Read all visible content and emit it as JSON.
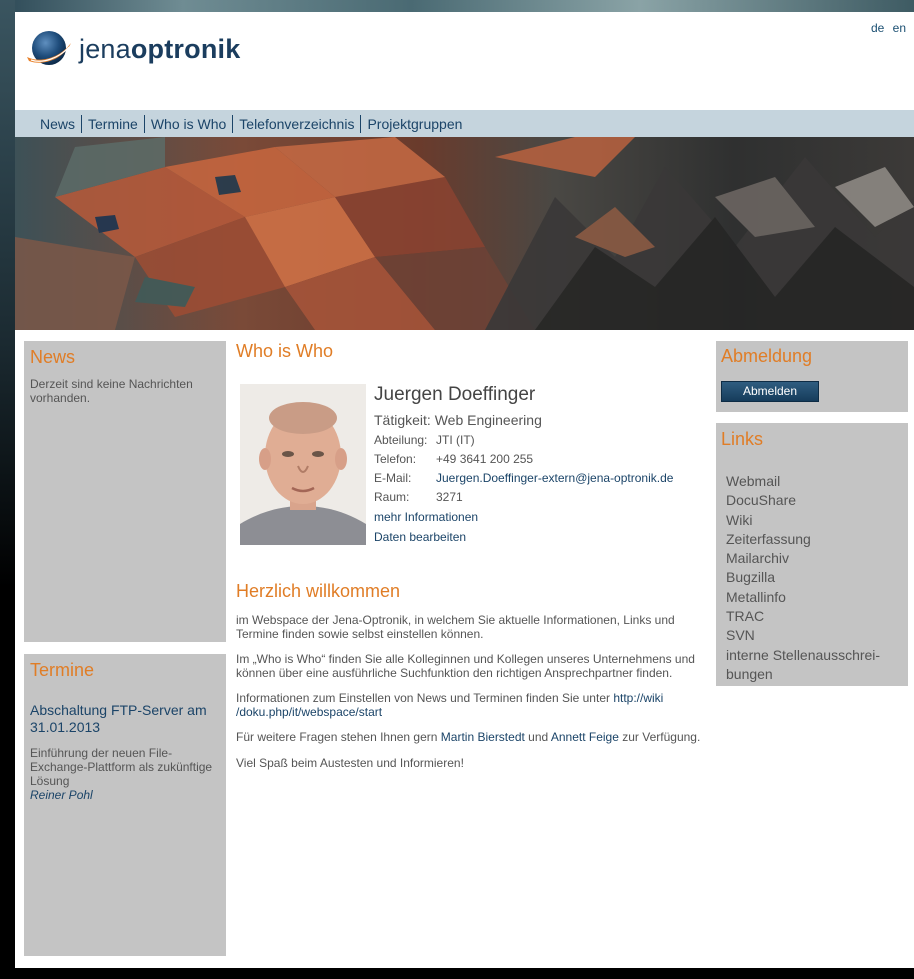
{
  "header": {
    "logo_prefix": "jena",
    "logo_bold": "optronik",
    "lang": [
      "de",
      "en"
    ]
  },
  "nav": [
    "News",
    "Termine",
    "Who is Who",
    "Telefonverzeichnis",
    "Projektgruppen"
  ],
  "news": {
    "title": "News",
    "text": "Derzeit sind keine Nachrichten vorhanden."
  },
  "termine": {
    "title": "Termine",
    "event_title": "Abschaltung FTP-Server am 31.01.2013",
    "event_desc": "Einführung der neuen File-Exchange-Plattform als zukünftige Lösung",
    "event_author": "Reiner Pohl"
  },
  "whoiswho": {
    "title": "Who is Who",
    "name": "Juergen Doeffinger",
    "job_label": "Tätigkeit:",
    "job_value": "Web Engineering",
    "rows": [
      {
        "label": "Abteilung:",
        "value": "JTI (IT)"
      },
      {
        "label": "Telefon:",
        "value": "+49 3641 200 255"
      },
      {
        "label": "E-Mail:",
        "value": "Juergen.Doeffinger-extern@jena-optronik.de"
      },
      {
        "label": "Raum:",
        "value": "3271"
      }
    ],
    "more_link": "mehr Informationen",
    "edit_link": "Daten bearbeiten"
  },
  "welcome": {
    "title": "Herzlich willkommen",
    "p1": "im Webspace der Jena-Optronik, in welchem Sie aktuelle Informationen, Links und Termine finden sowie selbst einstellen können.",
    "p2": "Im „Who is Who“ finden Sie alle Kolleginnen und Kollegen unseres Unternehmens und können über eine ausführliche Suchfunktion den richtigen Ansprechpartner finden.",
    "p3_text": "Informationen zum Einstellen von News und Terminen finden Sie unter ",
    "p3_link_a": "http://wiki",
    "p3_link_b": "/doku.php/it/webspace/start",
    "p4_pre": "Für weitere Fragen stehen Ihnen gern ",
    "p4_name1": "Martin Bierstedt",
    "p4_mid": " und ",
    "p4_name2": "Annett Feige",
    "p4_post": " zur Verfügung.",
    "p5": "Viel Spaß beim Austesten und Informieren!"
  },
  "abmeldung": {
    "title": "Abmeldung",
    "button": "Abmelden"
  },
  "links": {
    "title": "Links",
    "items": [
      "Webmail",
      "DocuShare",
      "Wiki",
      "Zeiterfassung",
      "Mailarchiv",
      "Bugzilla",
      "Metallinfo",
      "TRAC",
      "SVN",
      "interne Stellenausschrei-",
      "bungen"
    ]
  },
  "colors": {
    "accent_orange": "#e07d26",
    "link_blue": "#1b4468",
    "nav_bg": "#c5d4dd",
    "box_gray": "#c4c4c4"
  }
}
